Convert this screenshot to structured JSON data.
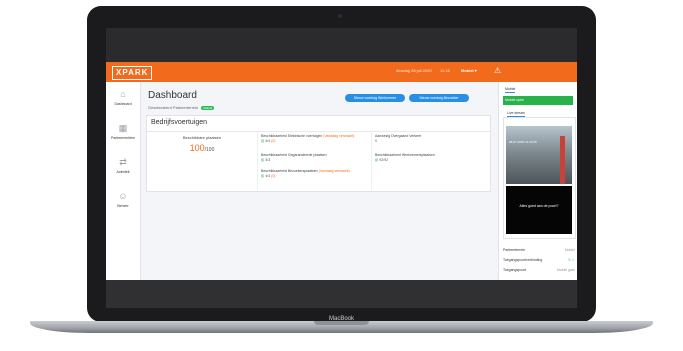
{
  "device": {
    "brand": "MacBook"
  },
  "topbar": {
    "logo": "XPARK",
    "date": "dinsdag 28 juli 2020",
    "time": "11:16",
    "user_menu": "Mobiel ▾",
    "alert_icon": "warning-icon",
    "bg_color": "#f26b1d"
  },
  "sidebar": {
    "items": [
      {
        "label": "Dashboard",
        "icon": "dashboard-icon"
      },
      {
        "label": "Parkeerrechten",
        "icon": "calendar-icon"
      },
      {
        "label": "Activiteit",
        "icon": "transfer-icon"
      },
      {
        "label": "Beheer",
        "icon": "user-icon"
      }
    ]
  },
  "main": {
    "title": "Dashboard",
    "subtitle": "Geselecteerd Parkeerterrein",
    "subtitle_badge": "Mobiel",
    "buttons": [
      {
        "label": "Nieuw voertuig Werknemer"
      },
      {
        "label": "Nieuw voertuig Bezoeker"
      }
    ],
    "accent_color": "#2a8fe4"
  },
  "panel": {
    "title": "Bedrijfsvoertuigen",
    "available": {
      "label": "Beschikbare plaatsen",
      "value": "100",
      "total": "/100"
    },
    "cells": [
      {
        "label": "Beschikbaarheid Elektrische voertuigen",
        "warn": "(Vandaag verwacht)",
        "value": "4/4",
        "extra": "(0)"
      },
      {
        "label": "Aanwezig Dvergaand Verkeer",
        "warn": "",
        "value": "0",
        "extra": ""
      },
      {
        "label": "Beschikbaarheid Gegarandeerde plaatsen",
        "warn": "",
        "value": "3/3",
        "extra": ""
      },
      {
        "label": "Beschikbaarheid Werknemersplaatsen",
        "warn": "",
        "value": "92/92",
        "extra": ""
      },
      {
        "label": "Beschikbaarheid Bezoekersplaatsen",
        "warn": "(Vandaag verwacht)",
        "value": "4/4",
        "extra": "(0)"
      }
    ]
  },
  "right": {
    "tab1": "Mobiel",
    "status_text": "Mobiel open",
    "tab2": "Live stream",
    "cam_timestamp": "28-07-2020 11:16:25",
    "cam_question": "Alles goed aan de poort?",
    "info": [
      {
        "label": "Parkeerterrein",
        "value": "Mobiel"
      },
      {
        "label": "Toegangspoortverbinding",
        "value": "↻ ✓"
      },
      {
        "label": "Toegangspoort",
        "value": "Mobiel gate"
      }
    ]
  }
}
